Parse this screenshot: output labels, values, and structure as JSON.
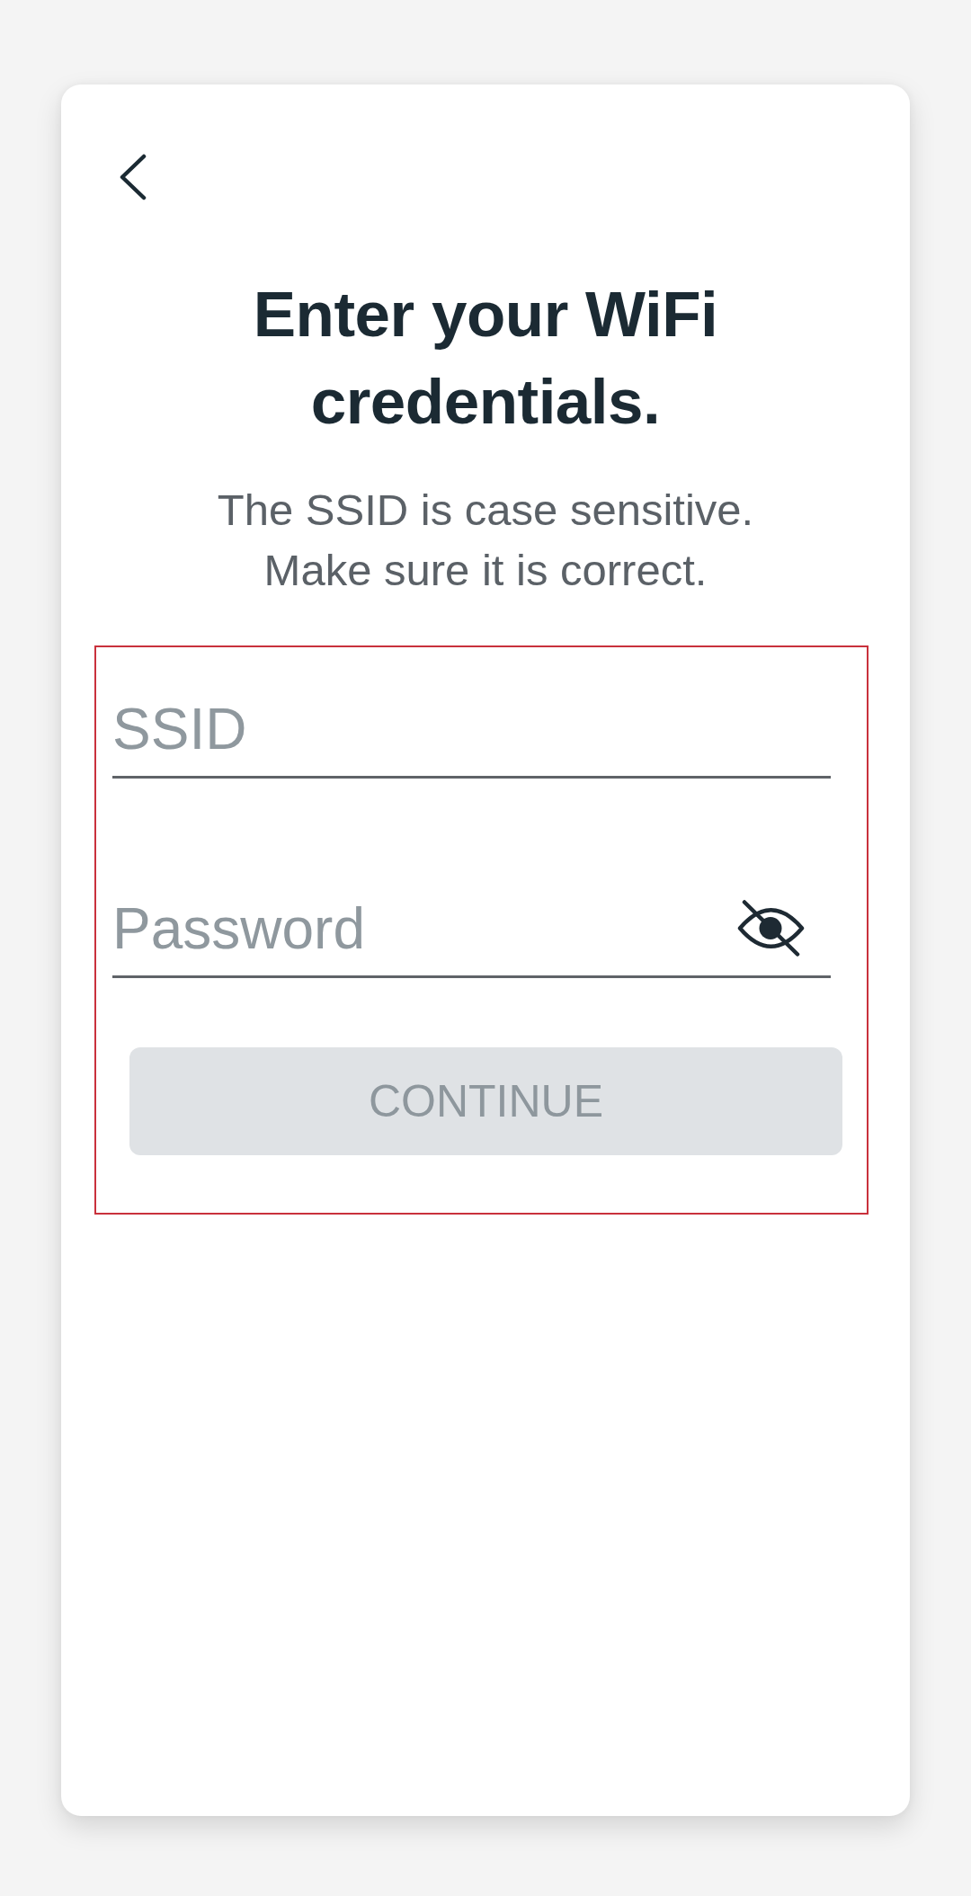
{
  "title": "Enter your WiFi credentials.",
  "subtitle": "The SSID is case sensitive. Make sure it is correct.",
  "form": {
    "highlighted": true,
    "fields": [
      {
        "kind": "text",
        "placeholder": "SSID"
      },
      {
        "kind": "password",
        "placeholder": "Password",
        "show_password": false
      }
    ],
    "submit": {
      "label": "CONTINUE",
      "disabled": true
    }
  }
}
